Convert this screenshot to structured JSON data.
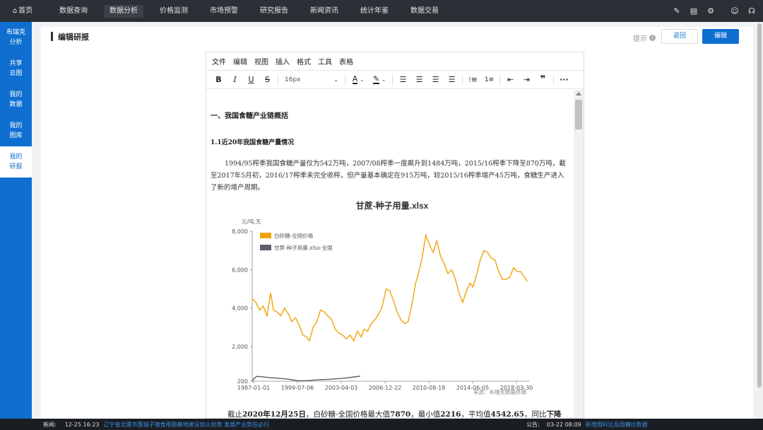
{
  "nav": {
    "items": [
      {
        "label": "首页",
        "icon": "home-icon"
      },
      {
        "label": "数据查询"
      },
      {
        "label": "数据分析",
        "active": true
      },
      {
        "label": "价格监测"
      },
      {
        "label": "市场预警"
      },
      {
        "label": "研究报告"
      },
      {
        "label": "新闻资讯"
      },
      {
        "label": "统计年鉴"
      },
      {
        "label": "数据交易"
      }
    ],
    "right_icons": [
      "edit-icon",
      "table-icon",
      "gear-icon",
      "user-icon",
      "headset-icon"
    ]
  },
  "sidebar": {
    "items": [
      {
        "line1": "布瑞克",
        "line2": "分析"
      },
      {
        "line1": "共享",
        "line2": "云图"
      },
      {
        "line1": "我的",
        "line2": "数据"
      },
      {
        "line1": "我的",
        "line2": "图库"
      },
      {
        "line1": "我的",
        "line2": "研报",
        "active": true
      }
    ]
  },
  "header": {
    "title": "编辑研报",
    "hint": "提示",
    "back_label": "返回",
    "edit_label": "编辑"
  },
  "editor": {
    "menu": [
      "文件",
      "编辑",
      "视图",
      "插入",
      "格式",
      "工具",
      "表格"
    ],
    "font_size": "16px",
    "heading1": "一、我国食糖产业链概括",
    "heading2": "1.1近20年我国食糖产量情况",
    "paragraph1": "1994/95榨季我国食糖产量仅为542万吨，2007/08榨季一度飙升到1484万吨，2015/16榨季下降至870万吨，截至2017年5月初，2016/17榨季未完全收榨，但产量基本确定在915万吨，较2015/16榨季增产45万吨，食糖生产进入了新的增产周期。",
    "paragraph2": {
      "p1": "截止",
      "date": "2020年12月25日",
      "p2": "，白砂糖-全国价格最大值",
      "max": "7870",
      "p3": "，最小值",
      "min": "2216",
      "p4": "，平均值",
      "avg": "4542.65",
      "p5": "，同比",
      "tail": "下降"
    }
  },
  "chart_data": {
    "type": "line",
    "title": "甘蔗-种子用量.xlsx",
    "ylabel": "元/吨,无",
    "source": "来源：布瑞克数据终端",
    "ylim": [
      200,
      8000
    ],
    "yticks": [
      "8,000",
      "6,000",
      "4,000",
      "2,000",
      "200"
    ],
    "ytick_values": [
      8000,
      6000,
      4000,
      2000,
      200
    ],
    "xticks": [
      "1987-01-01",
      "1999-07-06",
      "2003-04-03",
      "2006-12-22",
      "2010-08-18",
      "2014-06-05",
      "2018-03-30"
    ],
    "legend_position": "top-left",
    "series": [
      {
        "name": "白砂糖-全国价格",
        "color": "#f0a30a",
        "points": [
          [
            0.0,
            4500
          ],
          [
            0.4,
            4300
          ],
          [
            0.8,
            3900
          ],
          [
            1.2,
            4100
          ],
          [
            1.6,
            3600
          ],
          [
            2.0,
            4800
          ],
          [
            2.3,
            3900
          ],
          [
            2.7,
            3800
          ],
          [
            3.1,
            3600
          ],
          [
            3.5,
            4000
          ],
          [
            3.9,
            3700
          ],
          [
            4.3,
            3300
          ],
          [
            4.7,
            3500
          ],
          [
            5.1,
            3100
          ],
          [
            5.5,
            2600
          ],
          [
            5.9,
            2500
          ],
          [
            6.2,
            2300
          ],
          [
            6.6,
            3000
          ],
          [
            7.0,
            3300
          ],
          [
            7.4,
            3900
          ],
          [
            7.8,
            3800
          ],
          [
            8.2,
            3600
          ],
          [
            8.6,
            3400
          ],
          [
            9.0,
            2900
          ],
          [
            9.4,
            2700
          ],
          [
            9.8,
            2600
          ],
          [
            10.2,
            2400
          ],
          [
            10.6,
            2600
          ],
          [
            11.0,
            2300
          ],
          [
            11.4,
            2800
          ],
          [
            11.8,
            2500
          ],
          [
            12.1,
            2900
          ],
          [
            12.5,
            2800
          ],
          [
            12.9,
            3200
          ],
          [
            13.3,
            3400
          ],
          [
            13.7,
            3700
          ],
          [
            14.1,
            4100
          ],
          [
            14.5,
            5000
          ],
          [
            14.9,
            4900
          ],
          [
            15.3,
            4400
          ],
          [
            15.7,
            3800
          ],
          [
            16.1,
            3400
          ],
          [
            16.5,
            3200
          ],
          [
            16.9,
            3300
          ],
          [
            17.3,
            4200
          ],
          [
            17.7,
            5300
          ],
          [
            18.0,
            5800
          ],
          [
            18.4,
            6600
          ],
          [
            18.8,
            7800
          ],
          [
            19.2,
            7300
          ],
          [
            19.6,
            6900
          ],
          [
            20.0,
            7500
          ],
          [
            20.4,
            6700
          ],
          [
            20.8,
            6300
          ],
          [
            21.2,
            5800
          ],
          [
            21.6,
            6000
          ],
          [
            22.0,
            5500
          ],
          [
            22.4,
            4800
          ],
          [
            22.8,
            4300
          ],
          [
            23.2,
            4900
          ],
          [
            23.6,
            5300
          ],
          [
            23.9,
            5100
          ],
          [
            24.3,
            5700
          ],
          [
            24.7,
            6500
          ],
          [
            25.1,
            7000
          ],
          [
            25.5,
            6900
          ],
          [
            25.9,
            6600
          ],
          [
            26.3,
            6500
          ],
          [
            26.7,
            5900
          ],
          [
            27.1,
            5500
          ],
          [
            27.5,
            5500
          ],
          [
            27.9,
            5600
          ],
          [
            28.3,
            6100
          ],
          [
            28.7,
            5900
          ],
          [
            29.1,
            5900
          ],
          [
            29.5,
            5600
          ],
          [
            29.8,
            5400
          ]
        ]
      },
      {
        "name": "甘蔗-种子用量.xlsx-全国",
        "color": "#5a5f6b",
        "points": [
          [
            0.0,
            200
          ],
          [
            0.2,
            350
          ],
          [
            0.5,
            450
          ],
          [
            1.0,
            430
          ],
          [
            2.0,
            380
          ],
          [
            3.0,
            350
          ],
          [
            4.0,
            300
          ],
          [
            5.0,
            220
          ],
          [
            6.0,
            230
          ],
          [
            7.0,
            270
          ],
          [
            8.0,
            290
          ],
          [
            9.0,
            320
          ],
          [
            10.0,
            360
          ],
          [
            11.0,
            420
          ],
          [
            11.7,
            460
          ]
        ]
      }
    ]
  },
  "ticker": {
    "news_label": "新闻:",
    "news_time": "12-25 16:23",
    "news_text": "辽宁省北票市惠城子镇食用菌基地建设如火如荼 发展产业势在必行",
    "notice_label": "公告:",
    "notice_time": "03-22 08:09",
    "notice_text": "新增国料比及国糖比数据"
  }
}
